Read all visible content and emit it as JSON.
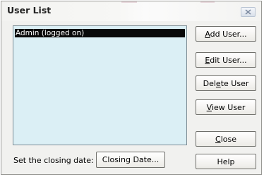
{
  "window": {
    "title": "User List"
  },
  "users": [
    {
      "label": "Admin (logged on)",
      "selected": true
    }
  ],
  "buttons": {
    "add_user": {
      "mnemonic": "A",
      "rest": "dd User..."
    },
    "edit_user": {
      "mnemonic": "E",
      "rest": "dit User..."
    },
    "delete_user": {
      "pre": "Del",
      "mnemonic": "e",
      "rest": "te User"
    },
    "view_user": {
      "mnemonic": "V",
      "rest": "iew User"
    },
    "close": {
      "mnemonic": "C",
      "rest": "lose"
    },
    "help": "Help",
    "closing_date": "Closing Date..."
  },
  "closing_date_label": "Set the closing date:",
  "icons": {
    "title_close": "close-icon"
  },
  "colors": {
    "list_background": "#dbeff5",
    "selection": "#090909",
    "window": "#f1f1ef"
  }
}
